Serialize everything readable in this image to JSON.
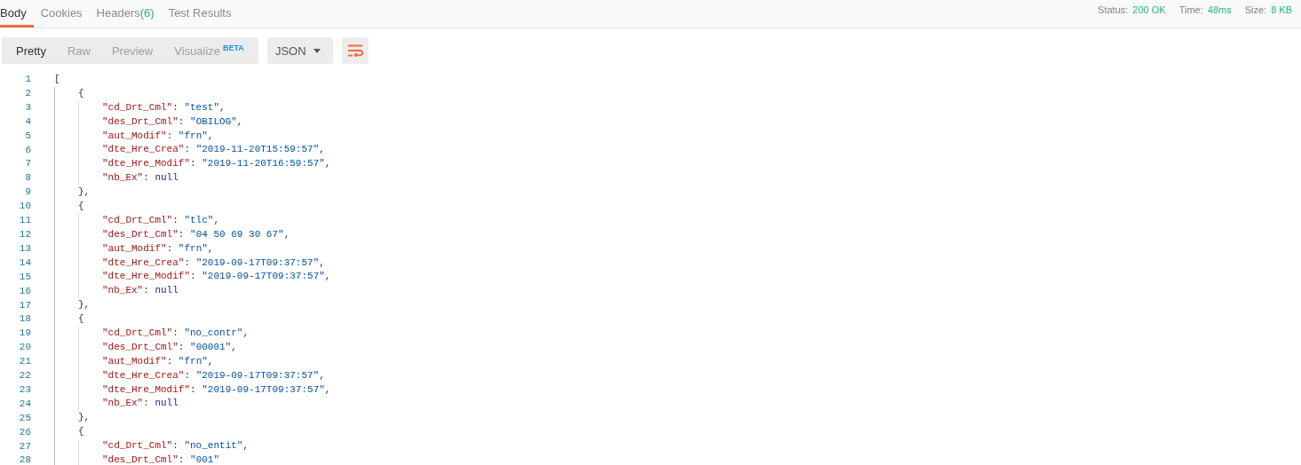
{
  "tabs": [
    {
      "label": "Body",
      "selected": true
    },
    {
      "label": "Cookies",
      "selected": false
    },
    {
      "label": "Headers",
      "count": "(6)",
      "selected": false
    },
    {
      "label": "Test Results",
      "selected": false
    }
  ],
  "status": [
    {
      "label": "Status:",
      "value": "200 OK"
    },
    {
      "label": "Time:",
      "value": "48ms"
    },
    {
      "label": "Size:",
      "value": "8 KB"
    }
  ],
  "views": [
    {
      "label": "Pretty",
      "selected": true
    },
    {
      "label": "Raw",
      "selected": false
    },
    {
      "label": "Preview",
      "selected": false
    },
    {
      "label": "Visualize",
      "badge": "BETA",
      "selected": false
    }
  ],
  "format": "JSON",
  "code": {
    "line_numbers": [
      "1",
      "2",
      "3",
      "4",
      "5",
      "6",
      "7",
      "8",
      "9",
      "10",
      "11",
      "12",
      "13",
      "14",
      "15",
      "16",
      "17",
      "18",
      "19",
      "20",
      "21",
      "22",
      "23",
      "24",
      "25",
      "26",
      "27",
      "28"
    ],
    "open": "[",
    "items": [
      {
        "open": "{",
        "close": "},",
        "fields": [
          {
            "key": "\"cd_Drt_Cml\"",
            "sep": ": ",
            "value": "\"test\"",
            "kind": "string",
            "punct": ","
          },
          {
            "key": "\"des_Drt_Cml\"",
            "sep": ": ",
            "value": "\"OBILOG\"",
            "kind": "string",
            "punct": ","
          },
          {
            "key": "\"aut_Modif\"",
            "sep": ": ",
            "value": "\"frn\"",
            "kind": "string",
            "punct": ","
          },
          {
            "key": "\"dte_Hre_Crea\"",
            "sep": ": ",
            "value": "\"2019-11-20T15:59:57\"",
            "kind": "string",
            "punct": ","
          },
          {
            "key": "\"dte_Hre_Modif\"",
            "sep": ": ",
            "value": "\"2019-11-20T16:59:57\"",
            "kind": "string",
            "punct": ","
          },
          {
            "key": "\"nb_Ex\"",
            "sep": ": ",
            "value": "null",
            "kind": "null"
          }
        ]
      },
      {
        "open": "{",
        "close": "},",
        "fields": [
          {
            "key": "\"cd_Drt_Cml\"",
            "sep": ": ",
            "value": "\"tlc\"",
            "kind": "string",
            "punct": ","
          },
          {
            "key": "\"des_Drt_Cml\"",
            "sep": ": ",
            "value": "\"04 50 69 30 67\"",
            "kind": "string",
            "punct": ","
          },
          {
            "key": "\"aut_Modif\"",
            "sep": ": ",
            "value": "\"frn\"",
            "kind": "string",
            "punct": ","
          },
          {
            "key": "\"dte_Hre_Crea\"",
            "sep": ": ",
            "value": "\"2019-09-17T09:37:57\"",
            "kind": "string",
            "punct": ","
          },
          {
            "key": "\"dte_Hre_Modif\"",
            "sep": ": ",
            "value": "\"2019-09-17T09:37:57\"",
            "kind": "string",
            "punct": ","
          },
          {
            "key": "\"nb_Ex\"",
            "sep": ": ",
            "value": "null",
            "kind": "null"
          }
        ]
      },
      {
        "open": "{",
        "close": "},",
        "fields": [
          {
            "key": "\"cd_Drt_Cml\"",
            "sep": ": ",
            "value": "\"no_contr\"",
            "kind": "string",
            "punct": ","
          },
          {
            "key": "\"des_Drt_Cml\"",
            "sep": ": ",
            "value": "\"00001\"",
            "kind": "string",
            "punct": ","
          },
          {
            "key": "\"aut_Modif\"",
            "sep": ": ",
            "value": "\"frn\"",
            "kind": "string",
            "punct": ","
          },
          {
            "key": "\"dte_Hre_Crea\"",
            "sep": ": ",
            "value": "\"2019-09-17T09:37:57\"",
            "kind": "string",
            "punct": ","
          },
          {
            "key": "\"dte_Hre_Modif\"",
            "sep": ": ",
            "value": "\"2019-09-17T09:37:57\"",
            "kind": "string",
            "punct": ","
          },
          {
            "key": "\"nb_Ex\"",
            "sep": ": ",
            "value": "null",
            "kind": "null"
          }
        ]
      },
      {
        "open": "{",
        "fields": [
          {
            "key": "\"cd_Drt_Cml\"",
            "sep": ": ",
            "value": "\"no_entit\"",
            "kind": "string",
            "punct": ","
          },
          {
            "key": "\"des_Drt_Cml\"",
            "sep": ": ",
            "value": "\"001\"",
            "kind": "string"
          }
        ]
      }
    ]
  }
}
